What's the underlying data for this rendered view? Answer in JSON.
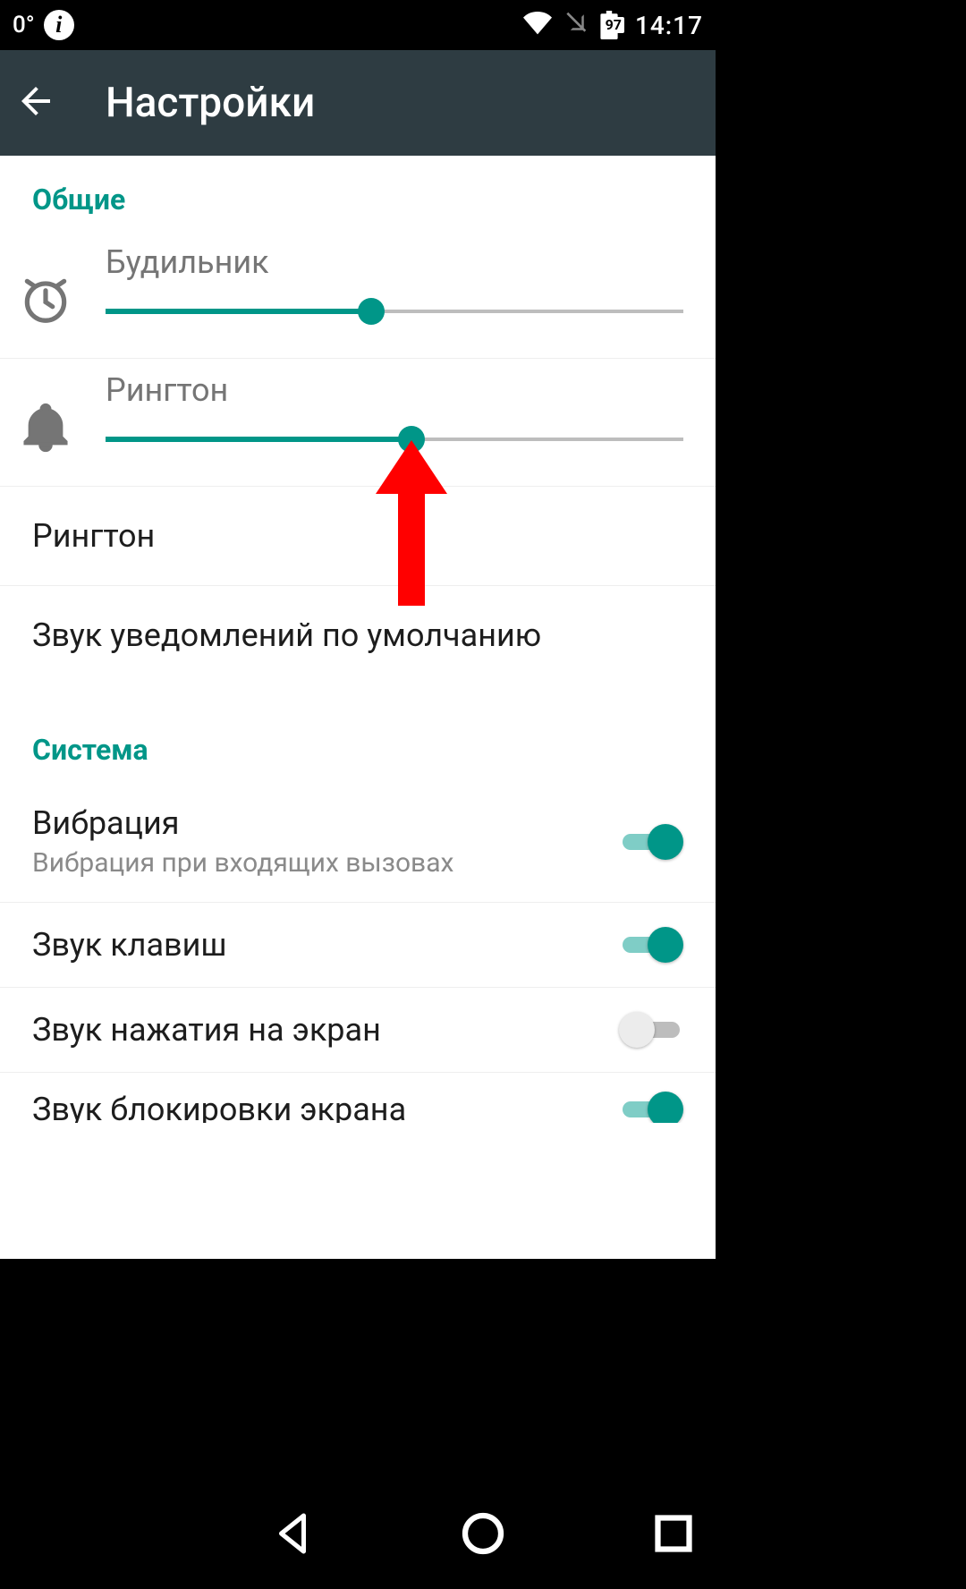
{
  "statusbar": {
    "temp": "0°",
    "battery_pct": "97",
    "clock": "14:17"
  },
  "appbar": {
    "title": "Настройки"
  },
  "sections": {
    "general_header": "Общие",
    "system_header": "Система"
  },
  "sliders": {
    "alarm": {
      "label": "Будильник",
      "value_pct": 46
    },
    "ringtone": {
      "label": "Рингтон",
      "value_pct": 53
    }
  },
  "rows": {
    "ringtone_label": "Рингтон",
    "default_notification_label": "Звук уведомлений по умолчанию"
  },
  "toggles": {
    "vibration": {
      "title": "Вибрация",
      "subtitle": "Вибрация при входящих вызовах",
      "on": true
    },
    "key_sound": {
      "title": "Звук клавиш",
      "on": true
    },
    "tap_sound": {
      "title": "Звук нажатия на экран",
      "on": false
    },
    "lock_sound": {
      "title": "Звук блокировки экрана",
      "on": true
    }
  },
  "colors": {
    "accent": "#009688"
  }
}
